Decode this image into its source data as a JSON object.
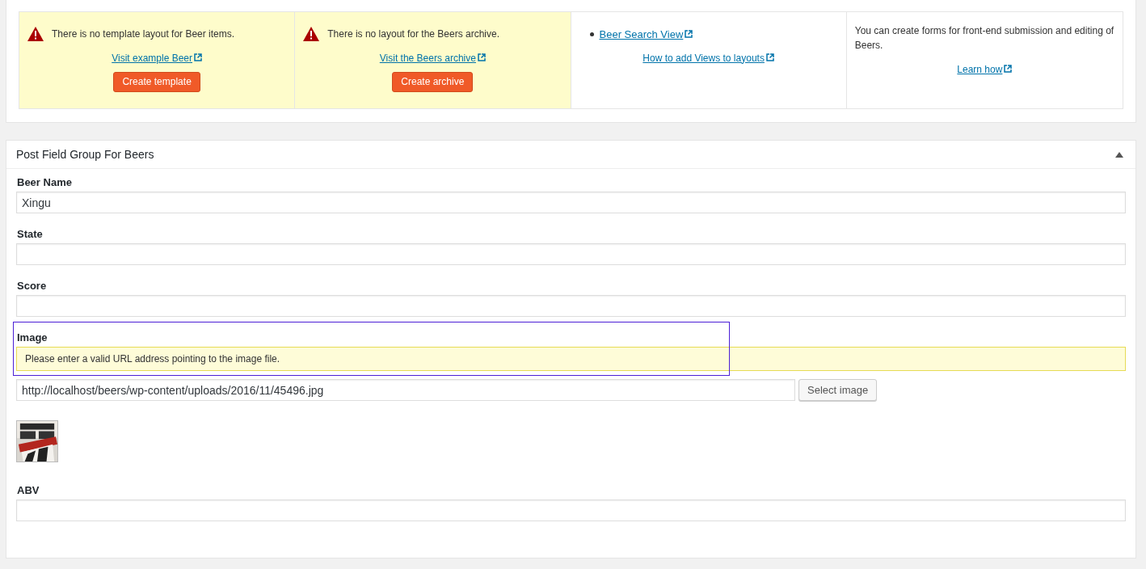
{
  "cards": [
    {
      "kind": "warning",
      "message": "There is no template layout for Beer items.",
      "link": "Visit example Beer",
      "button": "Create template"
    },
    {
      "kind": "warning",
      "message": "There is no layout for the Beers archive.",
      "link": "Visit the Beers archive",
      "button": "Create archive"
    },
    {
      "kind": "views",
      "items": [
        "Beer Search View"
      ],
      "link": "How to add Views to layouts"
    },
    {
      "kind": "forms",
      "message": "You can create forms for front-end submission and editing of Beers.",
      "link": "Learn how"
    }
  ],
  "panel": {
    "title": "Post Field Group For Beers",
    "expanded": true,
    "fields": [
      {
        "kind": "text",
        "label": "Beer Name",
        "value": "Xingu"
      },
      {
        "kind": "text",
        "label": "State"
      },
      {
        "kind": "text",
        "label": "Score"
      },
      {
        "label": "Image",
        "error": "Please enter a valid URL address pointing to the image file.",
        "value": "http://localhost/beers/wp-content/uploads/2016/11/45496.jpg",
        "button": "Select image",
        "highlighted": true
      },
      {
        "kind": "text",
        "label": "ABV"
      }
    ]
  }
}
